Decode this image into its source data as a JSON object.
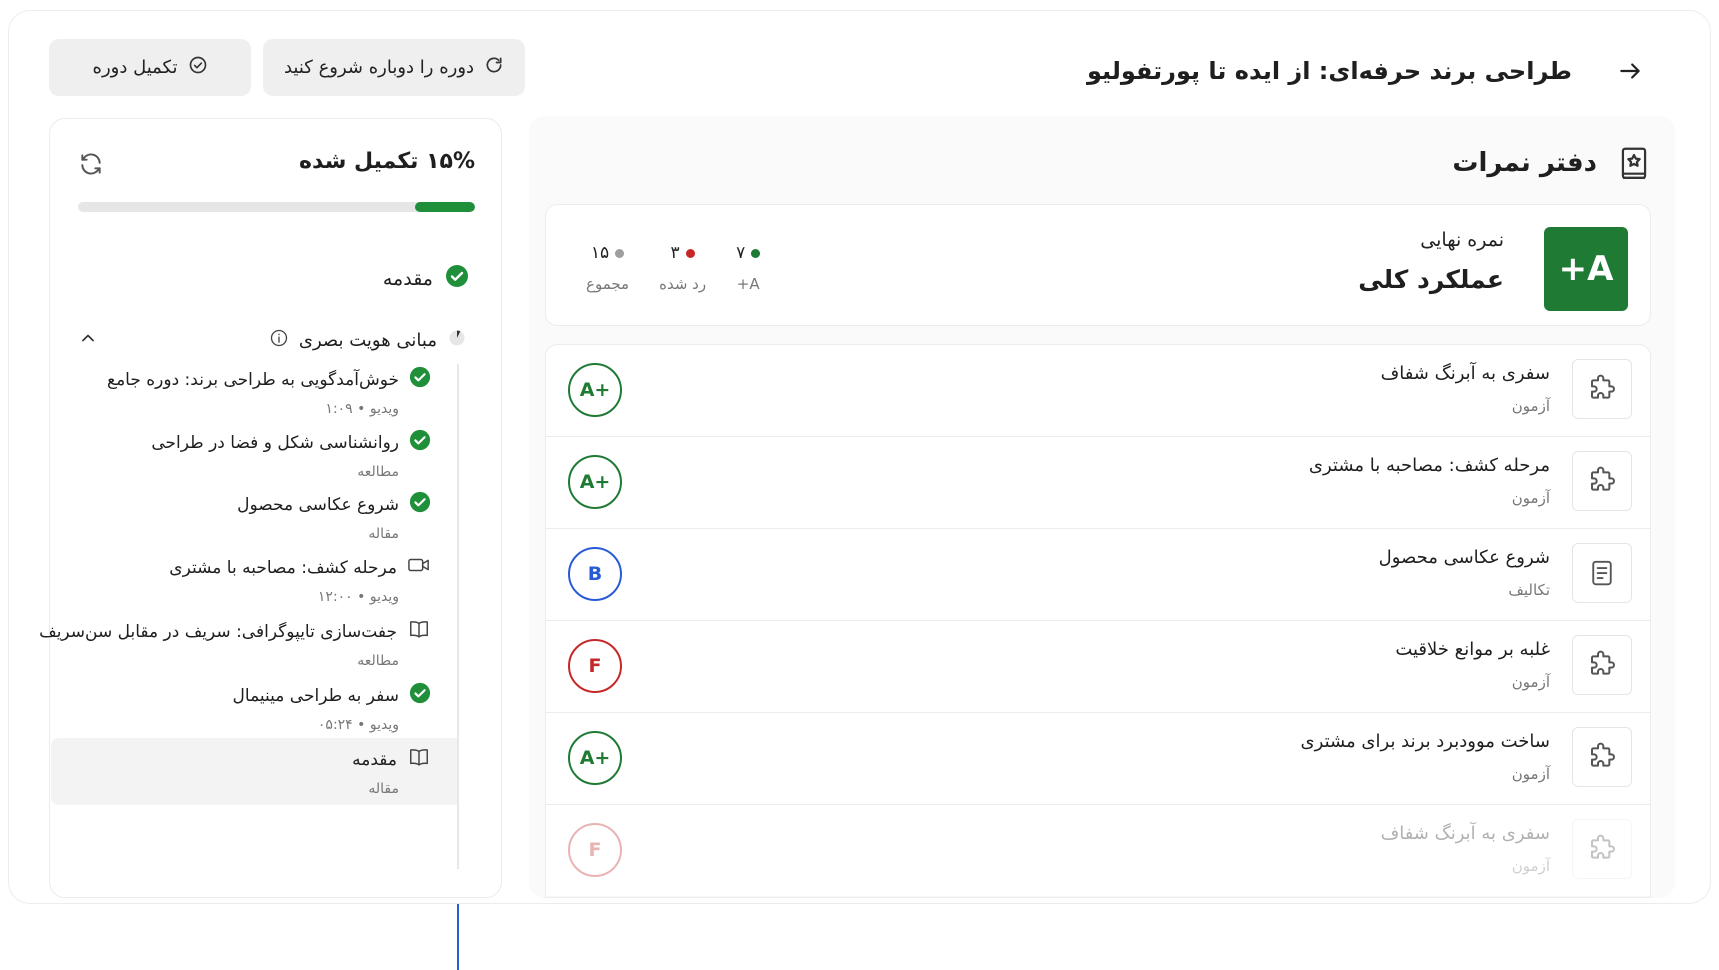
{
  "header": {
    "course_title": "طراحی برند حرفه‌ای: از ایده تا پورتفولیو",
    "restart_label": "دوره را دوباره شروع کنید",
    "complete_label": "تکمیل دوره"
  },
  "sidebar": {
    "progress_label": "۱۵% تکمیل شده",
    "progress_fraction": 0.15,
    "intro_label": "مقدمه",
    "module_label": "مبانی هویت بصری",
    "lessons": [
      {
        "title": "خوش‌آمدگویی به طراحی برند: دوره جامع",
        "meta": "ویدیو  •  ۱:۰۹",
        "icon": "check-circle-icon",
        "done": true
      },
      {
        "title": "روانشناسی شکل و فضا در طراحی",
        "meta": "مطالعه",
        "icon": "check-circle-icon",
        "done": true
      },
      {
        "title": "شروع عکاسی محصول",
        "meta": "مقاله",
        "icon": "check-circle-icon",
        "done": true
      },
      {
        "title": "مرحله کشف: مصاحبه با مشتری",
        "meta": "ویدیو  •  ۱۲:۰۰",
        "icon": "video-icon",
        "done": false
      },
      {
        "title": "جفت‌سازی تایپوگرافی: سریف در مقابل سن‌سریف",
        "meta": "مطالعه",
        "icon": "book-icon",
        "done": false
      },
      {
        "title": "سفر به طراحی مینیمال",
        "meta": "ویدیو  •  ۰۵:۲۴",
        "icon": "check-circle-icon",
        "done": true
      },
      {
        "title": "مقدمه",
        "meta": "مقاله",
        "icon": "book-icon",
        "done": false
      }
    ]
  },
  "gradebook": {
    "title": "دفتر نمرات",
    "final_grade_label": "نمره نهایی",
    "overall_label": "عملکرد کلی",
    "final_grade": "A+",
    "stats": [
      {
        "value": "۷",
        "label": "A+",
        "color": "#1f7a34"
      },
      {
        "value": "۳",
        "label": "رد شده",
        "color": "#c62828"
      },
      {
        "value": "۱۵",
        "label": "مجموع",
        "color": "#9e9e9e"
      }
    ],
    "items": [
      {
        "title": "سفری به آبرنگ شفاف",
        "type": "آزمون",
        "icon": "puzzle-icon",
        "grade": "A+",
        "color": "#1f7a34"
      },
      {
        "title": "مرحله کشف: مصاحبه با مشتری",
        "type": "آزمون",
        "icon": "puzzle-icon",
        "grade": "A+",
        "color": "#1f7a34"
      },
      {
        "title": "شروع عکاسی محصول",
        "type": "تکالیف",
        "icon": "document-icon",
        "grade": "B",
        "color": "#2a5bd7"
      },
      {
        "title": "غلبه بر موانع خلاقیت",
        "type": "آزمون",
        "icon": "puzzle-icon",
        "grade": "F",
        "color": "#c62828"
      },
      {
        "title": "ساخت موودبرد برند برای مشتری",
        "type": "آزمون",
        "icon": "puzzle-icon",
        "grade": "A+",
        "color": "#1f7a34"
      },
      {
        "title": "سفری به آبرنگ شفاف",
        "type": "آزمون",
        "icon": "puzzle-icon",
        "grade": "F",
        "color": "#c62828"
      }
    ]
  }
}
